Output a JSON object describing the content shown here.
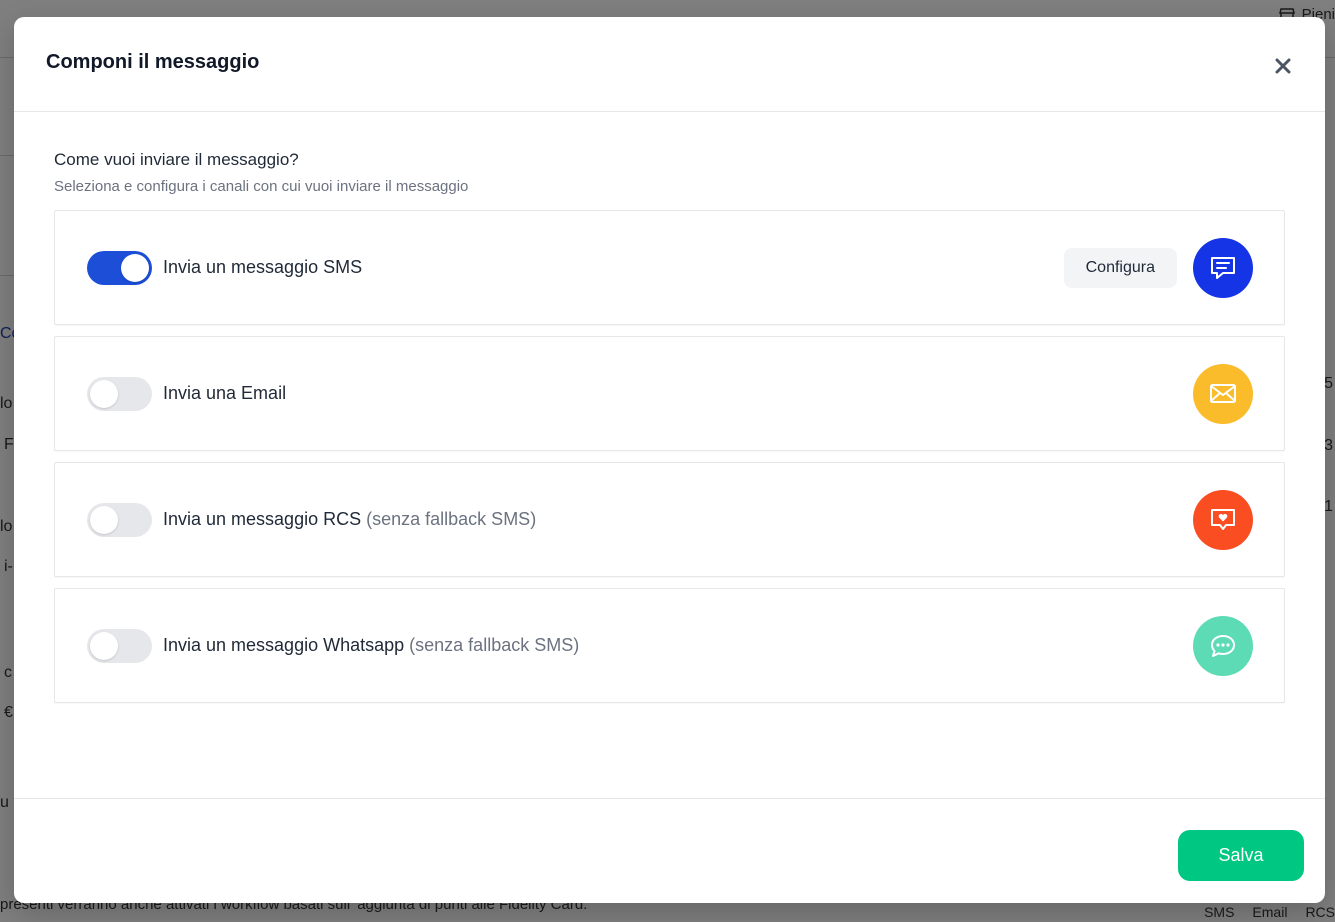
{
  "background": {
    "top_right_label": "Pieni",
    "bottom_text": "presenti verranno anche attivati i workflow basati sull' aggiunta di punti alle Fidelity Card.",
    "bottom_tabs": [
      "SMS",
      "Email",
      "RCS"
    ]
  },
  "modal": {
    "title": "Componi il messaggio",
    "question": "Come vuoi inviare il messaggio?",
    "hint": "Seleziona e configura i canali con cui vuoi inviare il messaggio",
    "channels": [
      {
        "label": "Invia un messaggio SMS",
        "suffix": "",
        "enabled": true,
        "configure_label": "Configura",
        "icon": "chat-lines-icon",
        "color": "#1434e6"
      },
      {
        "label": "Invia una Email",
        "suffix": "",
        "enabled": false,
        "icon": "envelope-icon",
        "color": "#fbbc2c"
      },
      {
        "label": "Invia un messaggio RCS",
        "suffix": "(senza fallback SMS)",
        "enabled": false,
        "icon": "heart-chat-icon",
        "color": "#fa4d22"
      },
      {
        "label": "Invia un messaggio Whatsapp",
        "suffix": "(senza fallback SMS)",
        "enabled": false,
        "icon": "dots-chat-icon",
        "color": "#5ddbb5"
      }
    ],
    "save_label": "Salva"
  },
  "colors": {
    "toggle_on": "#1d4ed8",
    "toggle_off": "#e5e7eb",
    "save_button": "#00c781"
  }
}
